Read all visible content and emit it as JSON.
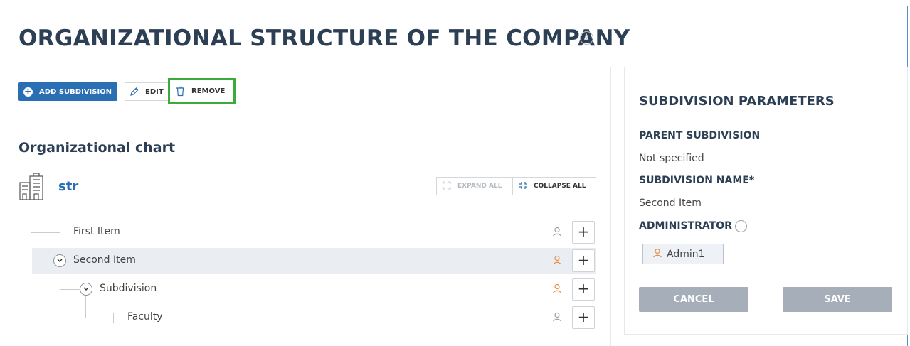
{
  "page": {
    "title": "ORGANIZATIONAL STRUCTURE OF THE COMPANY",
    "help_glyph": "?"
  },
  "toolbar": {
    "add_label": "ADD SUBDIVISION",
    "edit_label": "EDIT",
    "remove_label": "REMOVE"
  },
  "chart": {
    "title": "Organizational chart",
    "root_name": "str",
    "expand_all_label": "EXPAND ALL",
    "collapse_all_label": "COLLAPSE ALL",
    "items": [
      {
        "label": "First Item",
        "level": 1,
        "expanded": false,
        "person_color": "#9aa0a6"
      },
      {
        "label": "Second Item",
        "level": 1,
        "expanded": true,
        "selected": true,
        "person_color": "#e88a3a"
      },
      {
        "label": "Subdivision",
        "level": 2,
        "expanded": true,
        "person_color": "#e88a3a"
      },
      {
        "label": "Faculty",
        "level": 3,
        "expanded": false,
        "person_color": "#9aa0a6"
      }
    ],
    "add_child_glyph": "+"
  },
  "params": {
    "title": "SUBDIVISION PARAMETERS",
    "parent_label": "PARENT SUBDIVISION",
    "parent_value": "Not specified",
    "name_label": "SUBDIVISION NAME*",
    "name_value": "Second Item",
    "admin_label": "ADMINISTRATOR",
    "info_glyph": "i",
    "admin_value": "Admin1",
    "cancel_label": "CANCEL",
    "save_label": "SAVE"
  },
  "colors": {
    "accent": "#2a6fb4",
    "heading": "#2c3f54",
    "highlight_border": "#3bab3b",
    "person_active": "#e88a3a",
    "button_disabled": "#a6afb9"
  }
}
